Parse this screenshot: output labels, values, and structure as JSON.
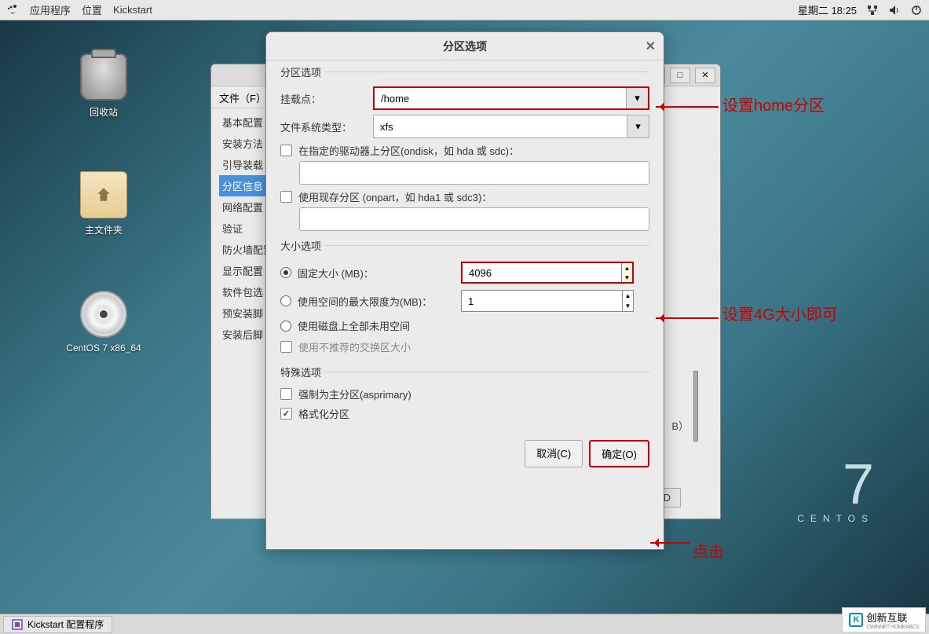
{
  "topbar": {
    "apps": "应用程序",
    "places": "位置",
    "appname": "Kickstart",
    "clock": "星期二 18:25"
  },
  "desktop": {
    "trash": "回收站",
    "home": "主文件夹",
    "disc": "CentOS 7 x86_64"
  },
  "centos": {
    "seven": "7",
    "word": "CENTOS"
  },
  "parent": {
    "file_menu": "文件（F）",
    "sidebar": [
      "基本配置",
      "安装方法",
      "引导装载",
      "分区信息",
      "网络配置",
      "验证",
      "防火墙配置",
      "显示配置",
      "软件包选",
      "预安装脚",
      "安装后脚"
    ]
  },
  "dialog": {
    "title": "分区选项",
    "section_part": "分区选项",
    "mount_label": "挂载点：",
    "mount_value": "/home",
    "fs_label": "文件系统类型：",
    "fs_value": "xfs",
    "ondisk_label": "在指定的驱动器上分区(ondisk，如 hda 或 sdc)：",
    "onpart_label": "使用现存分区 (onpart，如 hda1 或 sdc3)：",
    "section_size": "大小选项",
    "fixed_label": "固定大小 (MB)：",
    "fixed_value": "4096",
    "maxsize_label": "使用空间的最大限度为(MB)：",
    "maxsize_value": "1",
    "fillall_label": "使用磁盘上全部未用空间",
    "swaprec_label": "使用不推荐的交换区大小",
    "section_special": "特殊选项",
    "asprimary_label": "强制为主分区(asprimary)",
    "format_label": "格式化分区",
    "cancel": "取消(C)",
    "ok": "确定(O)"
  },
  "annotations": {
    "home": "设置home分区",
    "size": "设置4G大小即可",
    "click": "点击"
  },
  "taskbar": {
    "item": "Kickstart 配置程序"
  },
  "watermark": {
    "main": "创新互联",
    "sub": "CWINNET HOMEABCS"
  },
  "parent_extra": {
    "id": "ID",
    "b": "B）"
  }
}
